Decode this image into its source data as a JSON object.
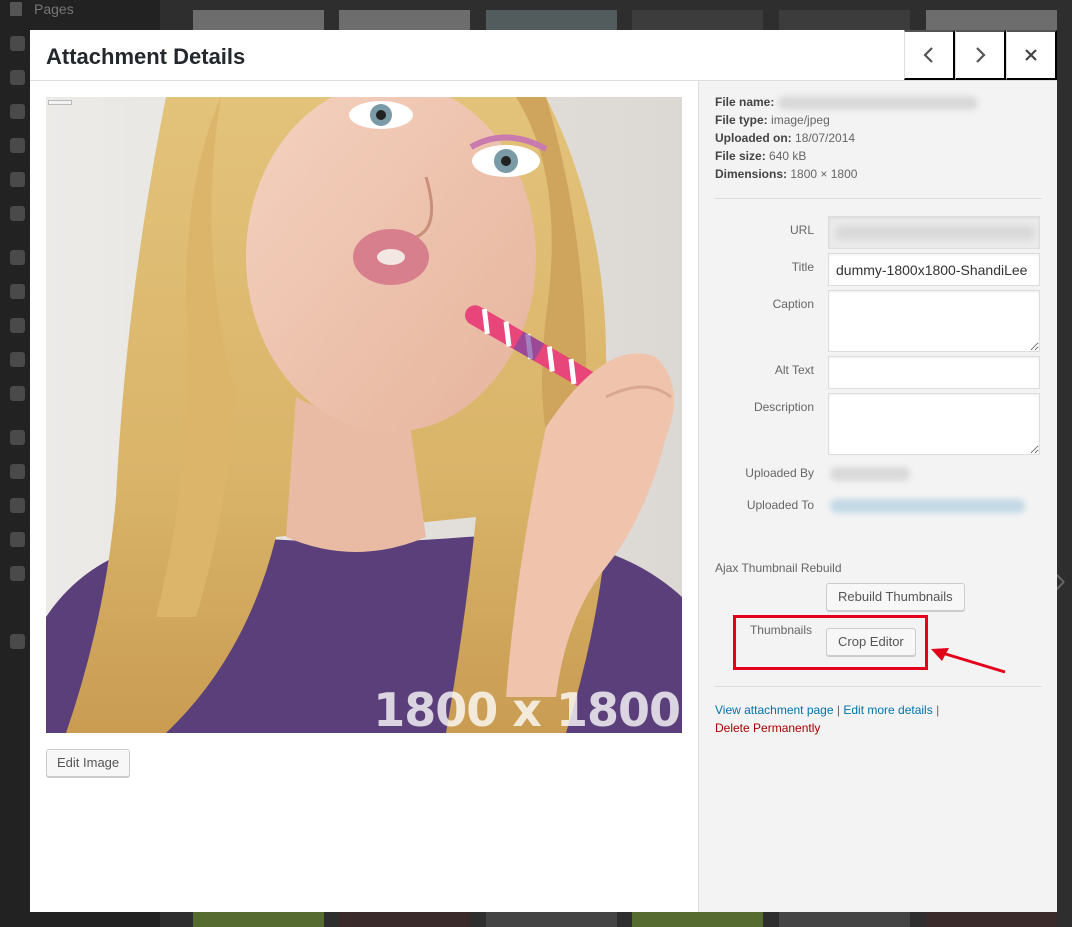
{
  "admin_sidebar": {
    "pages_label": "Pages"
  },
  "modal": {
    "title": "Attachment Details",
    "prev_label": "Previous",
    "next_label": "Next",
    "close_label": "Close"
  },
  "preview": {
    "image_caption": "1800 x 1800",
    "edit_image_label": "Edit Image"
  },
  "file_meta": {
    "file_name_key": "File name:",
    "file_type_key": "File type:",
    "file_type_value": "image/jpeg",
    "uploaded_on_key": "Uploaded on:",
    "uploaded_on_value": "18/07/2014",
    "file_size_key": "File size:",
    "file_size_value": "640 kB",
    "dimensions_key": "Dimensions:",
    "dimensions_value": "1800 × 1800"
  },
  "form": {
    "url_label": "URL",
    "title_label": "Title",
    "title_value": "dummy-1800x1800-ShandiLee",
    "caption_label": "Caption",
    "alt_text_label": "Alt Text",
    "description_label": "Description",
    "uploaded_by_label": "Uploaded By",
    "uploaded_to_label": "Uploaded To"
  },
  "thumbnail_rebuild": {
    "section_label": "Ajax Thumbnail Rebuild",
    "rebuild_button": "Rebuild Thumbnails",
    "thumbnails_label": "Thumbnails",
    "crop_editor_button": "Crop Editor"
  },
  "links": {
    "view_attachment": "View attachment page",
    "edit_more": "Edit more details",
    "separator": "|",
    "delete": "Delete Permanently"
  },
  "colors": {
    "link": "#0073aa",
    "delete": "#aa0000",
    "highlight": "#e2001a",
    "panel": "#f3f3f3"
  }
}
